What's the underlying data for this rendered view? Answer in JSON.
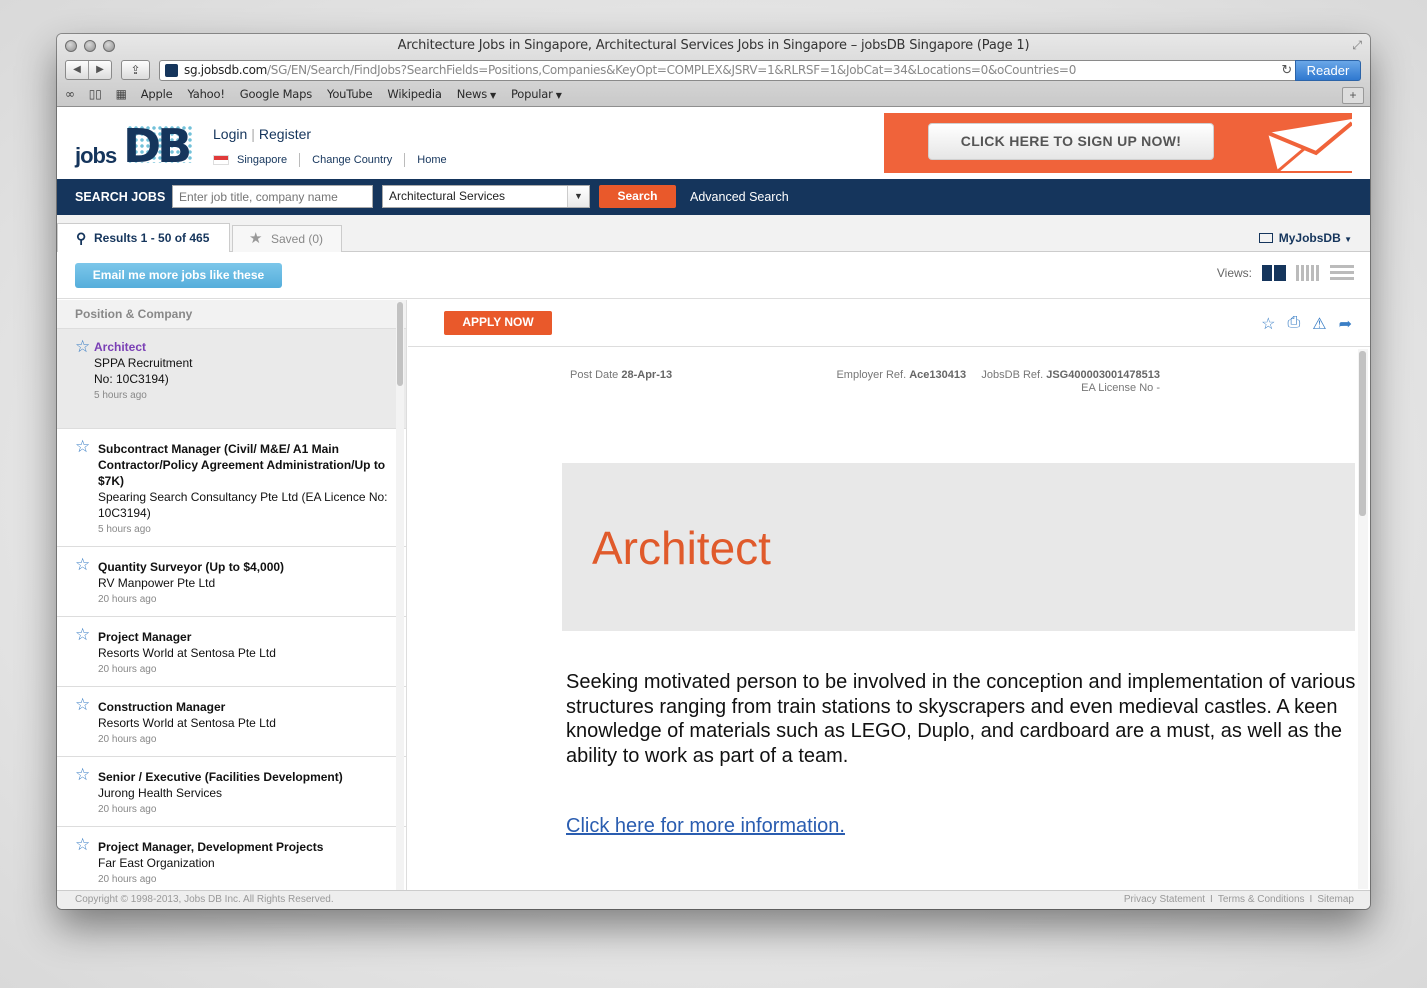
{
  "browser": {
    "window_title": "Architecture Jobs in Singapore, Architectural Services Jobs in Singapore – jobsDB Singapore (Page 1)",
    "url_host": "sg.jobsdb.com",
    "url_path": "/SG/EN/Search/FindJobs?SearchFields=Positions,Companies&KeyOpt=COMPLEX&JSRV=1&RLRSF=1&JobCat=34&Locations=0&oCountries=0",
    "reader_label": "Reader",
    "bookmarks": [
      "Apple",
      "Yahoo!",
      "Google Maps",
      "YouTube",
      "Wikipedia",
      "News",
      "Popular"
    ]
  },
  "header": {
    "logo_jobs": "jobs",
    "logo_db": "DB",
    "login": "Login",
    "register": "Register",
    "country": "Singapore",
    "change_country": "Change Country",
    "home": "Home",
    "signup_banner": "CLICK HERE TO SIGN UP NOW!"
  },
  "search": {
    "label": "SEARCH JOBS",
    "keyword_placeholder": "Enter job title, company name",
    "category": "Architectural Services",
    "button": "Search",
    "advanced": "Advanced Search"
  },
  "tabs": {
    "results": "Results 1 - 50 of 465",
    "saved": "Saved (0)",
    "myjobsdb": "MyJobsDB"
  },
  "actions": {
    "email_button": "Email me more jobs like these",
    "views_label": "Views:"
  },
  "list": {
    "header": "Position & Company",
    "jobs": [
      {
        "title": "Architect",
        "company": "SPPA Recruitment No: 10C3194)",
        "time": "5 hours ago"
      },
      {
        "title": "Subcontract Manager (Civil/ M&E/ A1 Main Contractor/Policy Agreement Administration/Up to $7K)",
        "company": "Spearing Search Consultancy Pte Ltd (EA Licence No: 10C3194)",
        "time": "5 hours ago"
      },
      {
        "title": "Quantity Surveyor (Up to $4,000)",
        "company": "RV Manpower Pte Ltd",
        "time": "20 hours ago"
      },
      {
        "title": "Project Manager",
        "company": "Resorts World at Sentosa Pte Ltd",
        "time": "20 hours ago"
      },
      {
        "title": "Construction Manager",
        "company": "Resorts World at Sentosa Pte Ltd",
        "time": "20 hours ago"
      },
      {
        "title": "Senior / Executive (Facilities Development)",
        "company": "Jurong Health Services",
        "time": "20 hours ago"
      },
      {
        "title": "Project Manager, Development Projects",
        "company": "Far East Organization",
        "time": "20 hours ago"
      }
    ]
  },
  "detail": {
    "apply_button": "APPLY NOW",
    "post_date_label": "Post Date",
    "post_date": "28-Apr-13",
    "employer_ref_label": "Employer Ref.",
    "employer_ref": "Ace130413",
    "jobsdb_ref_label": "JobsDB Ref.",
    "jobsdb_ref": "JSG400003001478513",
    "ea_license": "EA License No -",
    "title": "Architect",
    "description": "Seeking motivated person to be involved in the conception and implementation of various structures ranging from train stations to skyscrapers and even medieval castles. A keen knowledge of materials such as LEGO, Duplo, and cardboard are a must, as well as the ability to work as part of a team.",
    "more_link": "Click here for more information."
  },
  "footer": {
    "copyright": "Copyright © 1998-2013, Jobs DB Inc. All Rights Reserved.",
    "privacy": "Privacy Statement",
    "terms": "Terms & Conditions",
    "sitemap": "Sitemap"
  },
  "colors": {
    "navy": "#15355c",
    "orange": "#e9592b",
    "link_blue": "#3b7fc6"
  }
}
